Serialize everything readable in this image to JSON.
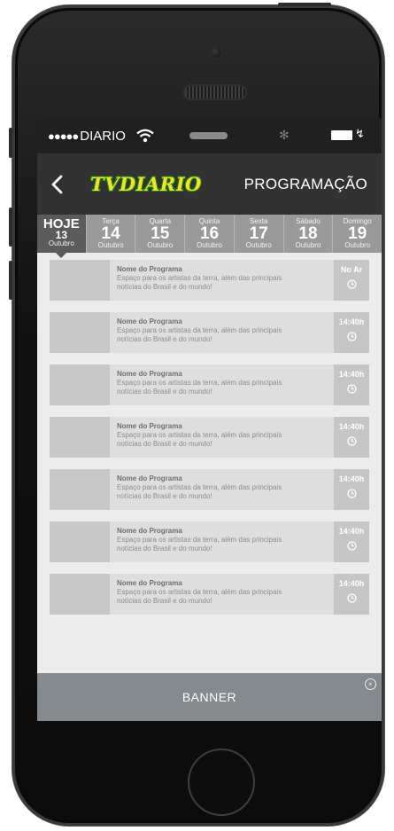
{
  "statusbar": {
    "dots": "●●●●●",
    "carrier": "DIARIO",
    "bt_glyph": "✻",
    "charge_glyph": "↯"
  },
  "navbar": {
    "back_glyph": "<",
    "logo": "TVDIARIO",
    "title": "PROGRAMAÇÃO"
  },
  "days": [
    {
      "name": "HOJE",
      "num": "13",
      "month": "Outubro",
      "active": true
    },
    {
      "name": "Terça",
      "num": "14",
      "month": "Outubro",
      "active": false
    },
    {
      "name": "Quarta",
      "num": "15",
      "month": "Outubro",
      "active": false
    },
    {
      "name": "Quinta",
      "num": "16",
      "month": "Outubro",
      "active": false
    },
    {
      "name": "Sexta",
      "num": "17",
      "month": "Outubro",
      "active": false
    },
    {
      "name": "Sábado",
      "num": "18",
      "month": "Outubro",
      "active": false
    },
    {
      "name": "Domingo",
      "num": "19",
      "month": "Outubro",
      "active": false
    }
  ],
  "programs": [
    {
      "name": "Nome do Programa",
      "desc1": "Espaço para os artistas da terra, além das principais",
      "desc2": "notícias do Brasil e do mundo!",
      "time": "No Ar"
    },
    {
      "name": "Nome do Programa",
      "desc1": "Espaço para os artistas da terra, além das principais",
      "desc2": "notícias do Brasil e do mundo!",
      "time": "14:40h"
    },
    {
      "name": "Nome do Programa",
      "desc1": "Espaço para os artistas da terra, além das principais",
      "desc2": "notícias do Brasil e do mundo!",
      "time": "14:40h"
    },
    {
      "name": "Nome do Programa",
      "desc1": "Espaço para os artistas da terra, além das principais",
      "desc2": "notícias do Brasil e do mundo!",
      "time": "14:40h"
    },
    {
      "name": "Nome do Programa",
      "desc1": "Espaço para os artistas da terra, além das principais",
      "desc2": "notícias do Brasil e do mundo!",
      "time": "14:40h"
    },
    {
      "name": "Nome do Programa",
      "desc1": "Espaço para os artistas da terra, além das principais",
      "desc2": "notícias do Brasil e do mundo!",
      "time": "14:40h"
    },
    {
      "name": "Nome do Programa",
      "desc1": "Espaço para os artistas da terra, além das principais",
      "desc2": "notícias do Brasil e do mundo!",
      "time": "14:40h"
    }
  ],
  "banner": {
    "label": "BANNER",
    "close_glyph": "×"
  },
  "colors": {
    "logo_yellow": "#f3e41c",
    "logo_green": "#1b7e2a",
    "nav_bg": "#323232",
    "day_active": "#5b5b5b",
    "day_inactive": "#9a9a9a",
    "banner_bg": "#848a8e"
  },
  "icons": {
    "wifi": "wifi-icon",
    "bluetooth": "bluetooth-icon",
    "battery": "battery-icon",
    "back": "chevron-left-icon",
    "clock": "clock-icon",
    "close": "close-icon"
  }
}
